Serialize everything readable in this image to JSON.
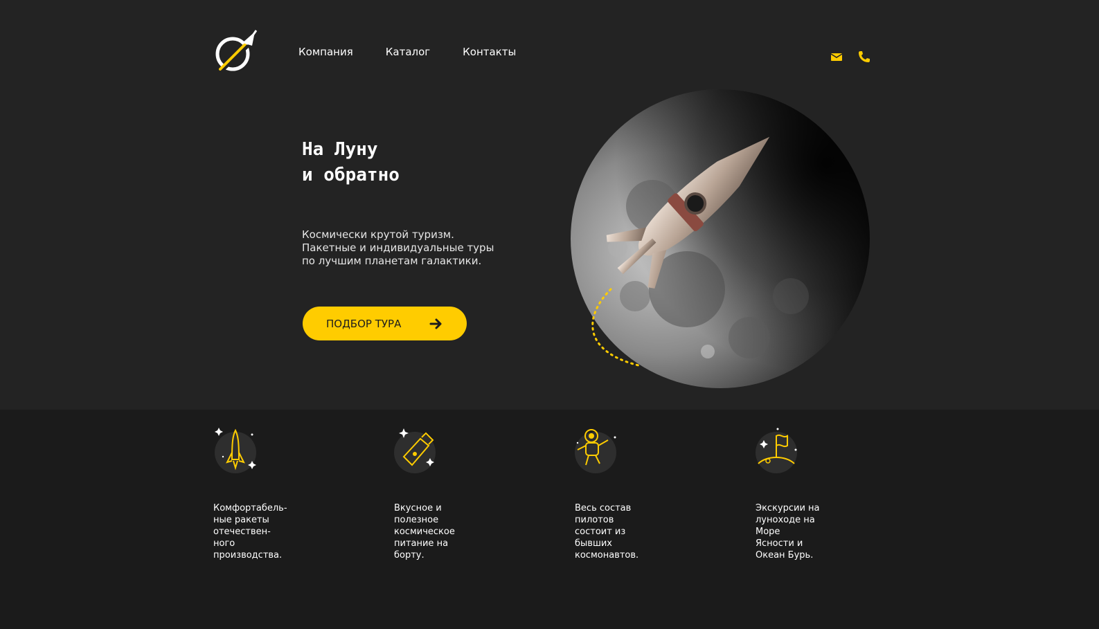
{
  "brand": {
    "logo_icon": "rocket-orbit-logo-icon",
    "accent_color": "#ffcc00"
  },
  "nav": {
    "items": [
      {
        "label": "Компания"
      },
      {
        "label": "Каталог"
      },
      {
        "label": "Контакты"
      }
    ]
  },
  "header": {
    "icons": [
      "mail-icon",
      "phone-icon"
    ]
  },
  "hero": {
    "title_lines": [
      "На Луну",
      "и обратно"
    ],
    "subtitle_lines": [
      "Космически крутой туризм.",
      "Пакетные и индивидуальные туры",
      "по лучшим планетам галактики."
    ],
    "cta_label": "ПОДБОР ТУРА"
  },
  "features": [
    {
      "icon": "rocket-icon",
      "lines": [
        "Комфортабель-",
        "ные ракеты",
        "отечествен-",
        "ного",
        "производства."
      ]
    },
    {
      "icon": "space-food-tube-icon",
      "lines": [
        "Вкусное и",
        "полезное",
        "космическое",
        "питание на",
        "борту."
      ]
    },
    {
      "icon": "astronaut-icon",
      "lines": [
        "Весь состав",
        "пилотов",
        "состоит из",
        "бывших",
        "космонавтов."
      ]
    },
    {
      "icon": "moon-flag-icon",
      "lines": [
        "Экскурсии на",
        "луноходе на",
        "Море",
        "Ясности и",
        "Океан Бурь."
      ]
    }
  ]
}
